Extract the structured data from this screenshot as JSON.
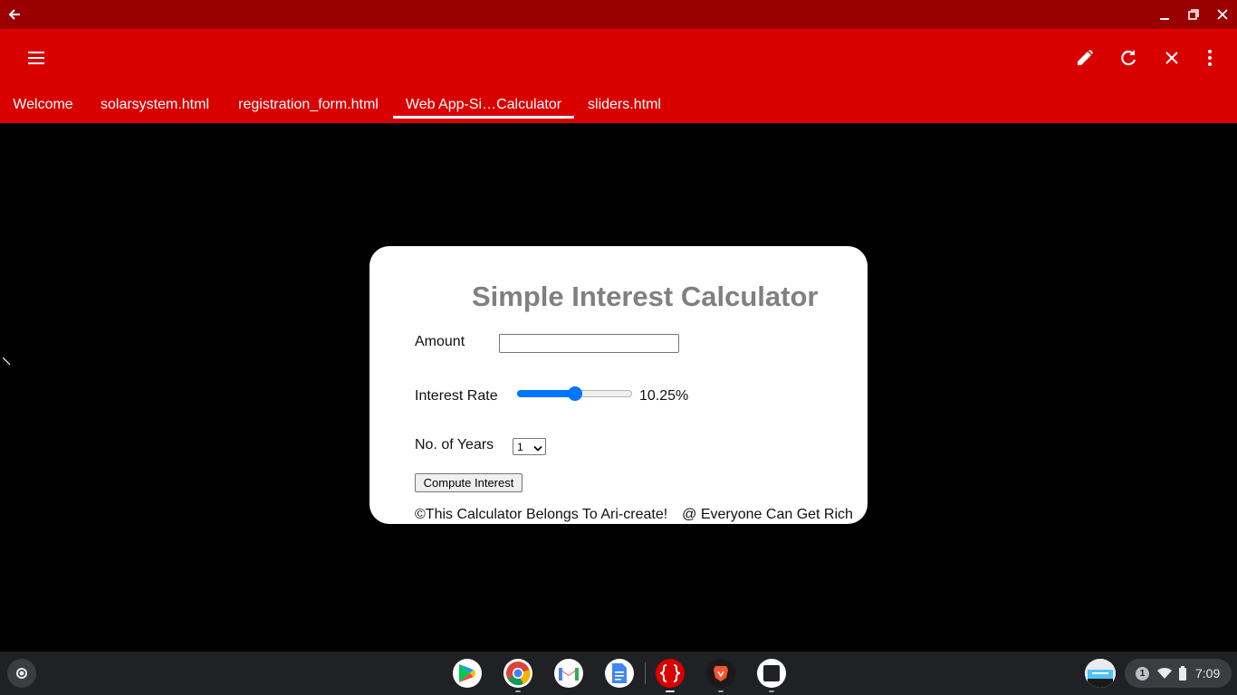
{
  "titlebar": {
    "back_icon": "arrow-left-icon",
    "controls": [
      "minimize-icon",
      "restore-icon",
      "close-icon"
    ]
  },
  "appbar": {
    "menu_icon": "hamburger-menu-icon",
    "actions": [
      "pencil-icon",
      "refresh-icon",
      "close-icon",
      "more-vert-icon"
    ],
    "color": "#d90000"
  },
  "tabs": [
    {
      "label": "Welcome",
      "active": false
    },
    {
      "label": "solarsystem.html",
      "active": false
    },
    {
      "label": "registration_form.html",
      "active": false
    },
    {
      "label": "Web App-Si…Calculator",
      "active": true
    },
    {
      "label": "sliders.html",
      "active": false
    }
  ],
  "calculator": {
    "title": "Simple Interest Calculator",
    "amount_label": "Amount",
    "amount_value": "",
    "rate_label": "Interest Rate",
    "rate_value": "10.25%",
    "rate_slider_fraction": 0.5,
    "years_label": "No. of Years",
    "years_selected": "1",
    "compute_label": "Compute Interest",
    "footer_left": "©This Calculator Belongs To Ari-create!",
    "footer_right": "@ Everyone Can Get Rich"
  },
  "shelf": {
    "apps": [
      "play-store-icon",
      "chrome-icon",
      "gmail-icon",
      "docs-icon",
      "code-editor-icon",
      "brave-icon",
      "terminal-icon"
    ],
    "notification_count": "1",
    "time": "7:09"
  }
}
